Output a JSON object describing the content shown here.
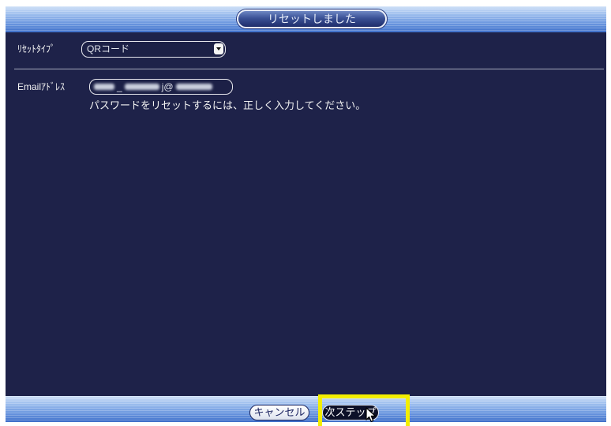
{
  "window": {
    "title": "リセットしました"
  },
  "form": {
    "reset_type": {
      "label": "ﾘｾｯﾄﾀｲﾌﾟ",
      "selected": "QRコード"
    },
    "email": {
      "label": "Emailｱﾄﾞﾚｽ",
      "visible_fragments": [
        "_",
        "j@"
      ]
    },
    "hint": "パスワードをリセットするには、正しく入力してください。"
  },
  "footer": {
    "cancel_label": "キャンセル",
    "next_label": "次ステップ"
  },
  "icons": {
    "dropdown": "chevron-down-icon",
    "pointer": "mouse-pointer-icon"
  },
  "colors": {
    "panel": "#1e2249",
    "bar_light": "#cfe0f7",
    "bar_dark": "#3f6fc9",
    "highlight": "#f3ee00",
    "text": "#f2f2f2"
  }
}
